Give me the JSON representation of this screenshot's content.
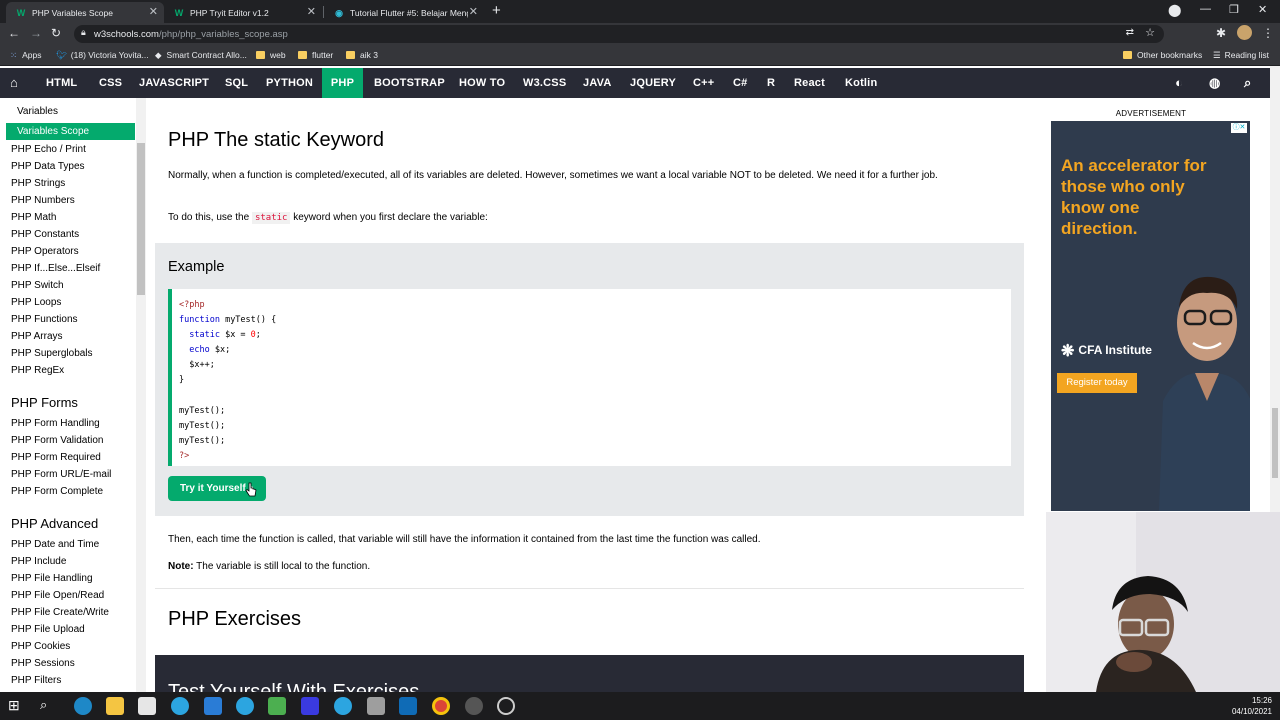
{
  "browser": {
    "tabs": [
      {
        "title": "PHP Variables Scope",
        "icon": "w3schools-favicon",
        "active": true
      },
      {
        "title": "PHP Tryit Editor v1.2",
        "icon": "w3schools-favicon",
        "active": false
      },
      {
        "title": "Tutorial Flutter #5: Belajar Meng...",
        "icon": "globe-favicon",
        "active": false
      }
    ],
    "url_host": "w3schools.com",
    "url_path": "/php/php_variables_scope.asp",
    "bookmarks": [
      "Apps",
      "(18) Victoria Yovita...",
      "Smart Contract Allo...",
      "web",
      "flutter",
      "aik 3"
    ],
    "bookmarks_right": [
      "Other bookmarks",
      "Reading list"
    ]
  },
  "navbar": {
    "items": [
      "HTML",
      "CSS",
      "JAVASCRIPT",
      "SQL",
      "PYTHON",
      "PHP",
      "BOOTSTRAP",
      "HOW TO",
      "W3.CSS",
      "JAVA",
      "JQUERY",
      "C++",
      "C#",
      "R",
      "React",
      "Kotlin"
    ],
    "active": "PHP"
  },
  "sidebar": {
    "items": [
      "Variables",
      "Variables Scope",
      "PHP Echo / Print",
      "PHP Data Types",
      "PHP Strings",
      "PHP Numbers",
      "PHP Math",
      "PHP Constants",
      "PHP Operators",
      "PHP If...Else...Elseif",
      "PHP Switch",
      "PHP Loops",
      "PHP Functions",
      "PHP Arrays",
      "PHP Superglobals",
      "PHP RegEx"
    ],
    "forms_heading": "PHP Forms",
    "forms_items": [
      "PHP Form Handling",
      "PHP Form Validation",
      "PHP Form Required",
      "PHP Form URL/E-mail",
      "PHP Form Complete"
    ],
    "advanced_heading": "PHP Advanced",
    "advanced_items": [
      "PHP Date and Time",
      "PHP Include",
      "PHP File Handling",
      "PHP File Open/Read",
      "PHP File Create/Write",
      "PHP File Upload",
      "PHP Cookies",
      "PHP Sessions",
      "PHP Filters"
    ]
  },
  "main": {
    "heading": "PHP The static Keyword",
    "para1": "Normally, when a function is completed/executed, all of its variables are deleted. However, sometimes we want a local variable NOT to be deleted. We need it for a further job.",
    "para2_before": "To do this, use the",
    "para2_code": "static",
    "para2_after": "keyword when you first declare the variable:",
    "example_title": "Example",
    "code": {
      "open_tag": "<?php",
      "l1_kw": "function",
      "l1_rest": " myTest() {",
      "l2_kw": "  static",
      "l2_mid": " $x = ",
      "l2_num": "0",
      "l2_end": ";",
      "l3_kw": "  echo",
      "l3_rest": " $x;",
      "l4": "  $x++;",
      "l5": "}",
      "call1": "myTest();",
      "call2": "myTest();",
      "call3": "myTest();",
      "close_tag": "?>"
    },
    "try_button": "Try it Yourself »",
    "para3": "Then, each time the function is called, that variable will still have the information it contained from the last time the function was called.",
    "note_label": "Note:",
    "note_text": "The variable is still local to the function.",
    "exercises_heading": "PHP Exercises",
    "exercises_bar": "Test Yourself With Exercises"
  },
  "ad": {
    "label": "ADVERTISEMENT",
    "headline": "An accelerator for those who only know one direction.",
    "brand": "CFA Institute",
    "cta": "Register today"
  },
  "taskbar": {
    "time": "15:26",
    "date": "04/10/2021"
  },
  "colors": {
    "accent": "#04aa6d",
    "navbar": "#282a35",
    "example_bg": "#e7e9eb",
    "ad_orange": "#f3a521"
  }
}
